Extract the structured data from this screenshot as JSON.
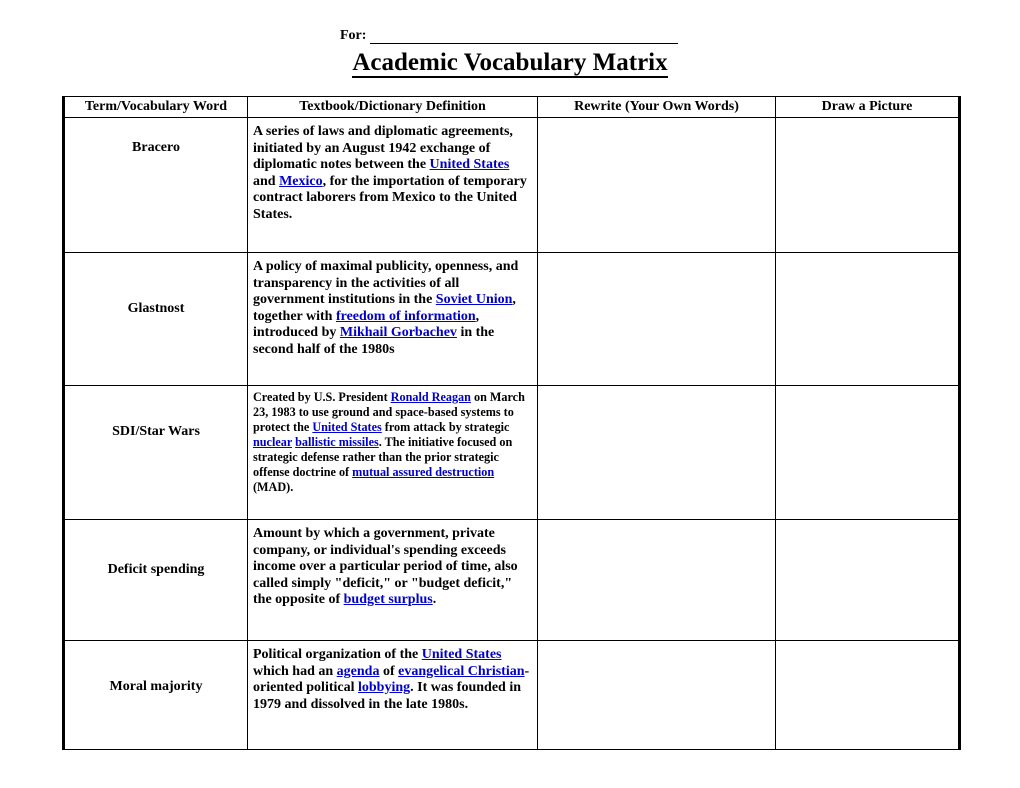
{
  "header": {
    "for_label": "For:",
    "for_blank_value": "",
    "title": "Academic Vocabulary Matrix"
  },
  "table": {
    "columns": [
      "Term/Vocabulary Word",
      "Textbook/Dictionary Definition",
      "Rewrite (Your Own Words)",
      "Draw a Picture"
    ],
    "link_color": "#0000cc",
    "rows": [
      {
        "term": "Bracero",
        "definition_parts": [
          {
            "text": "A series of laws and diplomatic agreements, initiated by an August 1942 exchange of diplomatic notes between the ",
            "link": false
          },
          {
            "text": "United States",
            "link": true
          },
          {
            "text": " and ",
            "link": false
          },
          {
            "text": "Mexico",
            "link": true
          },
          {
            "text": ", for the importation of temporary contract laborers from Mexico to the United States.",
            "link": false
          }
        ],
        "rewrite": "",
        "draw": "",
        "small_text": false
      },
      {
        "term": "Glastnost",
        "definition_parts": [
          {
            "text": "A policy of maximal publicity, openness, and transparency in the activities of all government institutions in the ",
            "link": false
          },
          {
            "text": "Soviet Union",
            "link": true
          },
          {
            "text": ", together with ",
            "link": false
          },
          {
            "text": "freedom of information",
            "link": true
          },
          {
            "text": ", introduced by ",
            "link": false
          },
          {
            "text": "Mikhail Gorbachev",
            "link": true
          },
          {
            "text": " in the second half of the 1980s",
            "link": false
          }
        ],
        "rewrite": "",
        "draw": "",
        "small_text": false
      },
      {
        "term": "SDI/Star Wars",
        "definition_parts": [
          {
            "text": "Created by U.S. President ",
            "link": false
          },
          {
            "text": "Ronald Reagan",
            "link": true
          },
          {
            "text": " on March 23, 1983 to use ground and space-based systems to protect the ",
            "link": false
          },
          {
            "text": "United States",
            "link": true
          },
          {
            "text": " from attack by strategic ",
            "link": false
          },
          {
            "text": "nuclear",
            "link": true
          },
          {
            "text": " ",
            "link": false
          },
          {
            "text": "ballistic missiles",
            "link": true
          },
          {
            "text": ". The initiative focused on strategic defense rather than the prior strategic offense doctrine of ",
            "link": false
          },
          {
            "text": "mutual assured destruction",
            "link": true
          },
          {
            "text": " (MAD).",
            "link": false
          }
        ],
        "rewrite": "",
        "draw": "",
        "small_text": true
      },
      {
        "term": "Deficit spending",
        "definition_parts": [
          {
            "text": "Amount by which a government, private company, or individual's spending exceeds income over a particular period of time, also called simply \"deficit,\" or \"budget deficit,\" the opposite of ",
            "link": false
          },
          {
            "text": "budget surplus",
            "link": true
          },
          {
            "text": ".",
            "link": false
          }
        ],
        "rewrite": "",
        "draw": "",
        "small_text": false
      },
      {
        "term": "Moral majority",
        "definition_parts": [
          {
            "text": "Political organization of the ",
            "link": false
          },
          {
            "text": "United States",
            "link": true
          },
          {
            "text": " which had an ",
            "link": false
          },
          {
            "text": "agenda",
            "link": true
          },
          {
            "text": " of ",
            "link": false
          },
          {
            "text": "evangelical Christian",
            "link": true
          },
          {
            "text": "-oriented political ",
            "link": false
          },
          {
            "text": "lobbying",
            "link": true
          },
          {
            "text": ". It was founded in 1979 and dissolved in the late 1980s.",
            "link": false
          }
        ],
        "rewrite": "",
        "draw": "",
        "small_text": false
      }
    ]
  }
}
